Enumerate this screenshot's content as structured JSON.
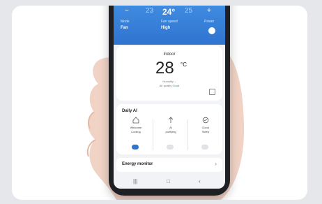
{
  "topbar": {
    "temp_left": "23",
    "temp_current": "24°",
    "temp_right": "25",
    "chips": [
      {
        "label": "Mode",
        "value": "Fan"
      },
      {
        "label": "Fan speed",
        "value": "High"
      },
      {
        "label": "Power",
        "value": ""
      }
    ]
  },
  "indoor": {
    "label": "Indoor",
    "temperature": "28",
    "unit": "°C",
    "status_line1": "Humidity --",
    "status_line2_prefix": "Air quality",
    "status_line2_value": "Good"
  },
  "ai": {
    "title": "Daily AI",
    "items": [
      {
        "label1": "Welcome",
        "label2": "Cooling",
        "enabled": true
      },
      {
        "label1": "AI",
        "label2": "purifying",
        "enabled": false
      },
      {
        "label1": "Good",
        "label2": "Sleep",
        "enabled": false
      }
    ]
  },
  "energy": {
    "label": "Energy monitor"
  },
  "colors": {
    "accent": "#2f74cf",
    "good": "#3a9a52"
  }
}
